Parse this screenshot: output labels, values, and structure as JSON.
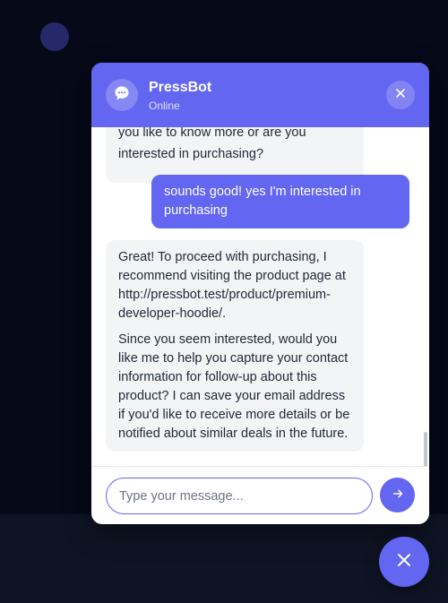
{
  "header": {
    "title": "PressBot",
    "status": "Online"
  },
  "messages": [
    {
      "role": "bot",
      "partial_top": "you like to know more or are you",
      "text": "interested in purchasing?"
    },
    {
      "role": "user",
      "text": "sounds good! yes I'm interested in purchasing"
    },
    {
      "role": "bot",
      "paragraphs": [
        "Great! To proceed with purchasing, I recommend visiting the product page at http://pressbot.test/product/premium-developer-hoodie/.",
        "Since you seem interested, would you like me to help you capture your contact information for follow-up about this product? I can save your email address if you'd like to receive more details or be notified about similar deals in the future."
      ]
    }
  ],
  "input": {
    "placeholder": "Type your message...",
    "value": ""
  },
  "icons": {
    "avatar": "chat-bubble-icon",
    "close": "close-icon",
    "send": "arrow-right-icon",
    "launcher": "close-icon"
  },
  "colors": {
    "accent": "#6366f1",
    "background": "#050918",
    "bot_bubble": "#f3f4f6"
  }
}
